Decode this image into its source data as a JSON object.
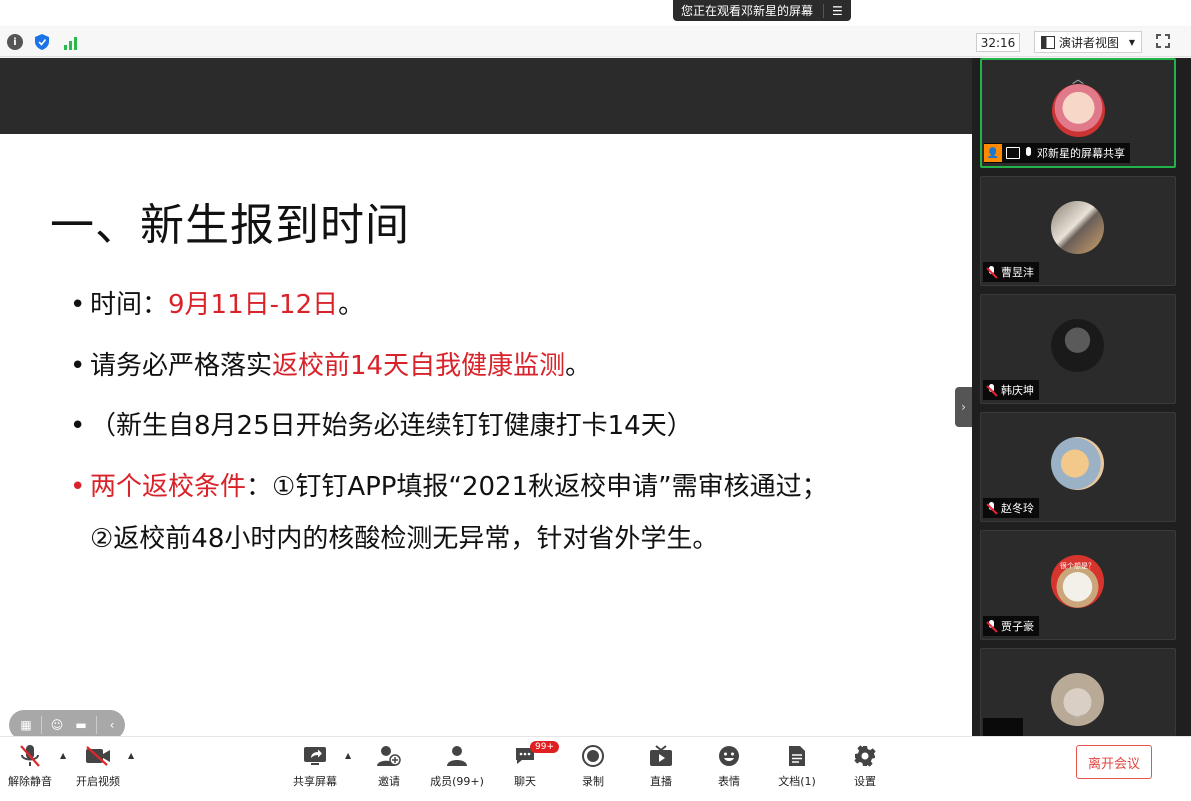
{
  "banner": {
    "viewing_text": "您正在观看邓新星的屏幕",
    "menu_glyph": "☰"
  },
  "topbar": {
    "timer": "32:16",
    "view_mode": "演讲者视图"
  },
  "slide": {
    "title": "一、新生报到时间",
    "bullets": [
      {
        "dot": "•",
        "prefix": "时间：",
        "highlight": "9月11日-12日",
        "suffix": "。"
      },
      {
        "dot": "•",
        "prefix": "请务必严格落实",
        "highlight": "返校前14天自我健康监测",
        "suffix": "。"
      },
      {
        "dot": "•",
        "text": "（新生自8月25日开始务必连续钉钉健康打卡14天）"
      },
      {
        "dot": "•",
        "highlight": "两个返校条件",
        "text": "：①钉钉APP填报“2021秋返校申请”需审核通过；"
      },
      {
        "text": "②返校前48小时内的核酸检测无异常，针对省外学生。"
      }
    ]
  },
  "participants": [
    {
      "name": "邓新星的屏幕共享"
    },
    {
      "name": "曹昱沣"
    },
    {
      "name": "韩庆坤"
    },
    {
      "name": "赵冬玲"
    },
    {
      "name": "贾子豪",
      "avatar_caption": "很个想是？"
    },
    {
      "name": ""
    }
  ],
  "toolbar": {
    "unmute": "解除静音",
    "start_video": "开启视频",
    "share_screen": "共享屏幕",
    "invite": "邀请",
    "members": "成员(99+)",
    "chat": "聊天",
    "chat_badge": "99+",
    "record": "录制",
    "live": "直播",
    "reactions": "表情",
    "docs": "文档(1)",
    "settings": "设置",
    "leave": "离开会议"
  },
  "colors": {
    "accent_red": "#d9232a",
    "active_border": "#24b24b",
    "leave": "#e04640"
  }
}
